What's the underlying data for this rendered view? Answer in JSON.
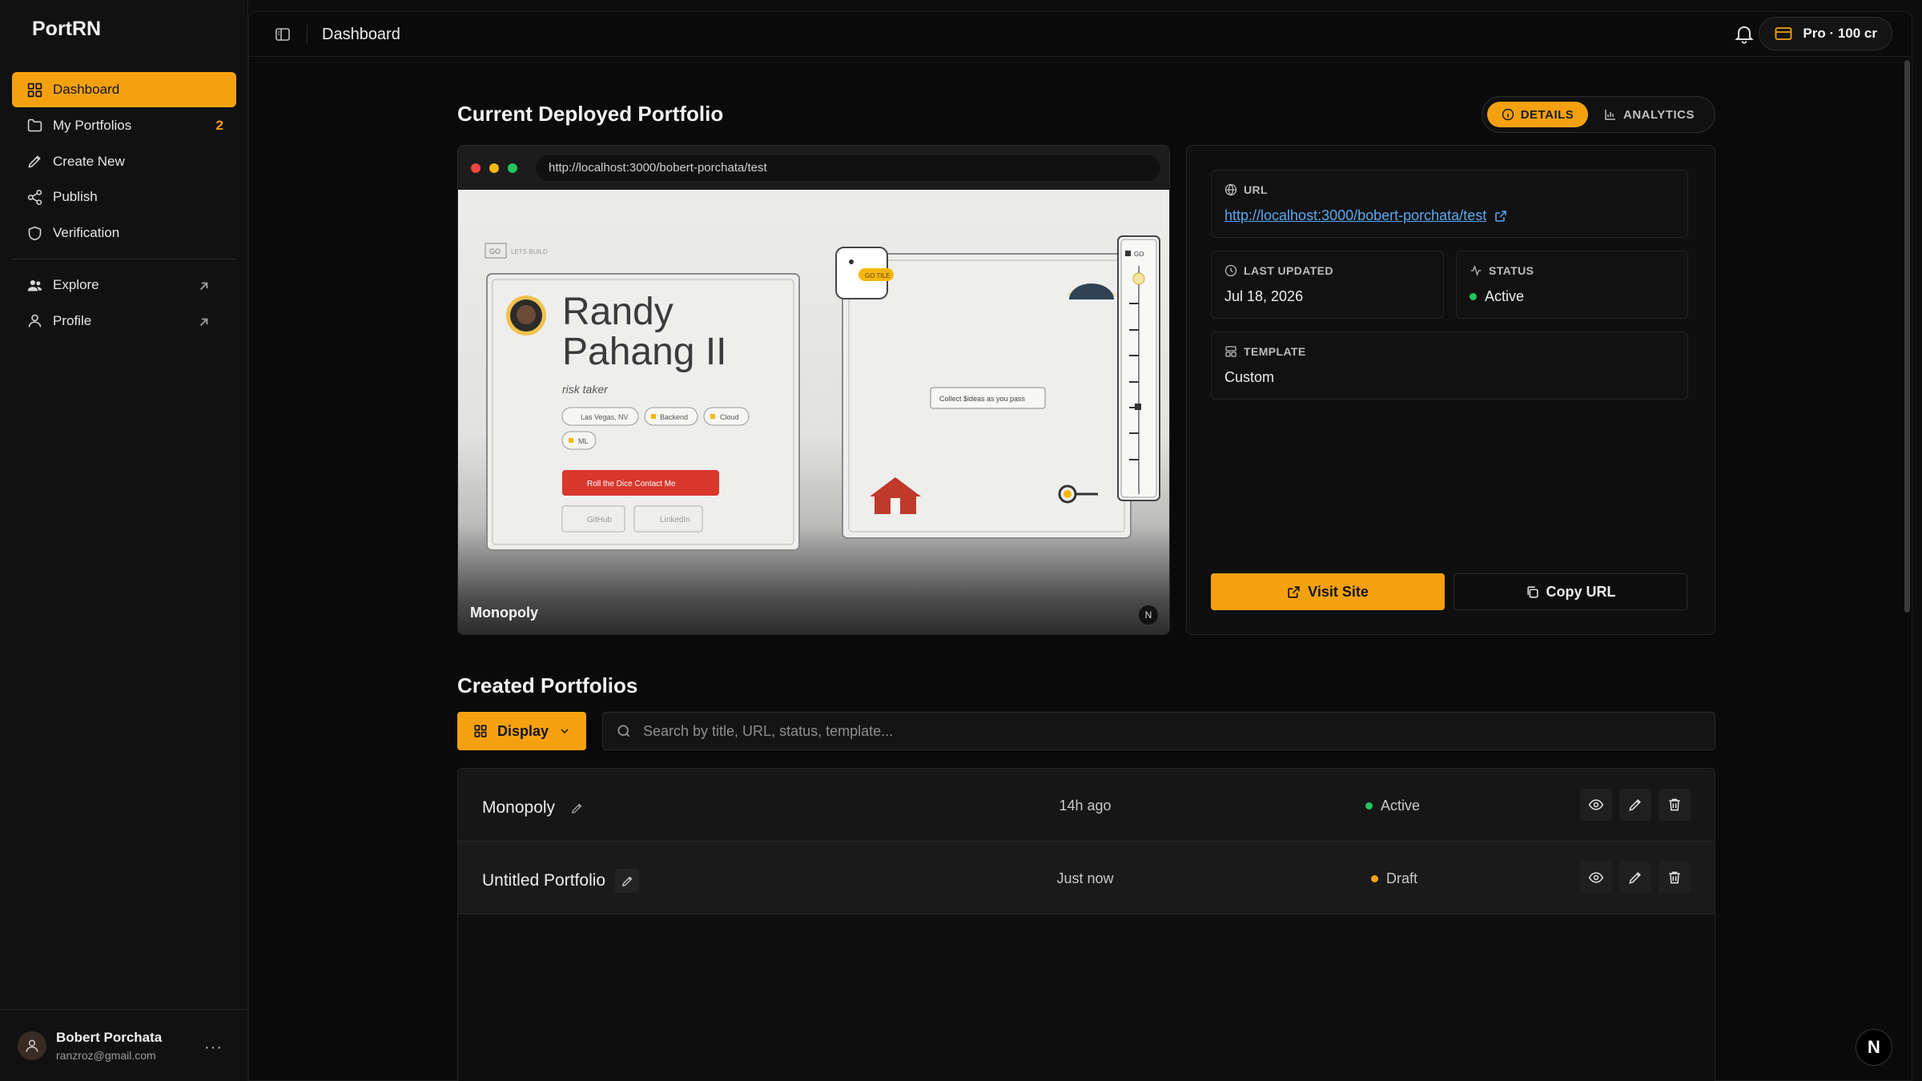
{
  "app": {
    "brand": "PortRN",
    "page_title": "Dashboard"
  },
  "sidebar": {
    "items": [
      {
        "label": "Dashboard",
        "icon": "grid-icon",
        "active": true
      },
      {
        "label": "My Portfolios",
        "icon": "folder-icon",
        "count": "2"
      },
      {
        "label": "Create New",
        "icon": "pencil-icon"
      },
      {
        "label": "Publish",
        "icon": "share-icon"
      },
      {
        "label": "Verification",
        "icon": "shield-icon"
      },
      {
        "label": "Explore",
        "icon": "users-icon",
        "external": true
      },
      {
        "label": "Profile",
        "icon": "user-icon",
        "external": true
      }
    ],
    "user": {
      "name": "Bobert Porchata",
      "email": "ranzroz@gmail.com",
      "more": "···"
    }
  },
  "topbar": {
    "plan": "Pro · 100 cr"
  },
  "deployed": {
    "heading": "Current Deployed Portfolio",
    "tabs": {
      "details": "DETAILS",
      "analytics": "ANALYTICS"
    },
    "preview": {
      "url": "http://localhost:3000/bobert-porchata/test",
      "name": "Monopoly",
      "badge": "N",
      "site": {
        "corner_tag": "GO",
        "corner_text": "LETS BUILD",
        "first_name": "Randy",
        "last_name": "Pahang II",
        "tagline": "risk taker",
        "tags": [
          "Las Vegas, NV",
          "Backend",
          "Cloud",
          "ML"
        ],
        "cta": "Roll the Dice Contact Me",
        "links": [
          "GitHub",
          "LinkedIn"
        ],
        "tile_label": "GO TILE",
        "board_note": "Collect $ideas as you pass",
        "side_tag": "GO"
      }
    },
    "details": {
      "url_label": "URL",
      "url_value": "http://localhost:3000/bobert-porchata/test",
      "updated_label": "LAST UPDATED",
      "updated_value": "Jul 18, 2026",
      "status_label": "STATUS",
      "status_value": "Active",
      "template_label": "TEMPLATE",
      "template_value": "Custom",
      "visit_label": "Visit Site",
      "copy_label": "Copy URL"
    }
  },
  "created": {
    "heading": "Created Portfolios",
    "display_label": "Display",
    "search_placeholder": "Search by title, URL, status, template...",
    "rows": [
      {
        "title": "Monopoly",
        "time": "14h ago",
        "status": "Active",
        "status_color": "#22c55e"
      },
      {
        "title": "Untitled Portfolio",
        "time": "Just now",
        "status": "Draft",
        "status_color": "#f5a10f"
      }
    ]
  },
  "floating_badge": "N",
  "colors": {
    "accent": "#f5a10f",
    "active": "#22c55e",
    "link": "#5aa9f0"
  }
}
